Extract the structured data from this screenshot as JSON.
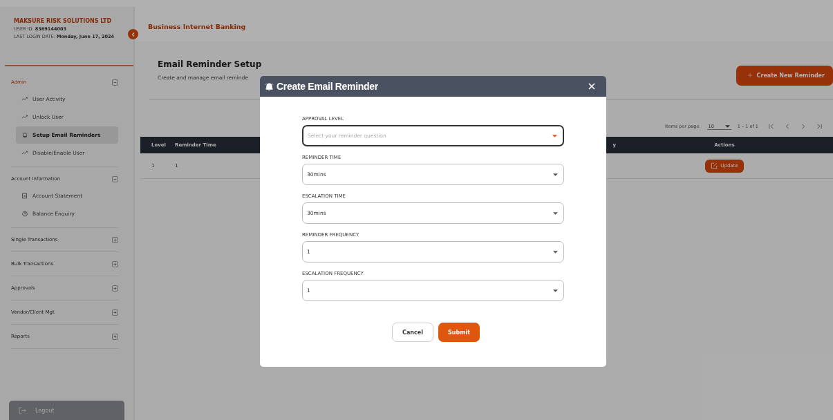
{
  "sidebar": {
    "company": "MAKSURE RISK SOLUTIONS LTD",
    "user_id_label": "USER ID:",
    "user_id": "8369144003",
    "last_login_label": "LAST LOGIN DATE:",
    "last_login": "Monday, June 17, 2024",
    "sections": [
      {
        "label": "Admin",
        "selected": true,
        "expanded": true,
        "items": [
          {
            "label": "User Activity",
            "kind": "trend",
            "selected": false
          },
          {
            "label": "Unlock User",
            "kind": "trend",
            "selected": false
          },
          {
            "label": "Setup Email Reminders",
            "kind": "bell",
            "selected": true
          },
          {
            "label": "Disable/Enable User",
            "kind": "trend",
            "selected": false
          }
        ]
      },
      {
        "label": "Account Information",
        "selected": false,
        "expanded": true,
        "items": [
          {
            "label": "Account Statement",
            "kind": "statement",
            "selected": false
          },
          {
            "label": "Balance Enquiry",
            "kind": "help",
            "selected": false
          }
        ]
      },
      {
        "label": "Single Transactions",
        "selected": false,
        "expanded": false
      },
      {
        "label": "Bulk Transactions",
        "selected": false,
        "expanded": false
      },
      {
        "label": "Approvals",
        "selected": false,
        "expanded": false
      },
      {
        "label": "Vendor/Client Mgt",
        "selected": false,
        "expanded": false
      },
      {
        "label": "Reports",
        "selected": false,
        "expanded": false
      }
    ],
    "logout": "Logout"
  },
  "header": {
    "title": "Business Internet Banking"
  },
  "page": {
    "title": "Email Reminder Setup",
    "subtitle": "Create and manage email reminde",
    "create_button": "Create New Reminder"
  },
  "paginator": {
    "label": "Items per page:",
    "page_size": "10",
    "range": "1 – 1 of 1"
  },
  "table": {
    "columns": [
      "Level",
      "Reminder Time",
      "y",
      "Actions"
    ],
    "rows": [
      {
        "cells": [
          "1",
          "1"
        ],
        "action": "Update"
      }
    ]
  },
  "dialog": {
    "title": "Create Email Reminder",
    "fields": [
      {
        "label": "APPROVAL LEVEL",
        "placeholder": "Select your reminder question",
        "focused": true
      },
      {
        "label": "REMINDER TIME",
        "value": "30mins",
        "focused": false
      },
      {
        "label": "ESCALATION TIME",
        "value": "30mins",
        "focused": false
      },
      {
        "label": "REMINDER FREQUENCY",
        "value": "1",
        "focused": false
      },
      {
        "label": "ESCALATION FREQUENCY",
        "value": "1",
        "focused": false
      }
    ],
    "buttons": [
      {
        "label": "Cancel",
        "kind": "secondary"
      },
      {
        "label": "Submit",
        "kind": "primary"
      }
    ]
  }
}
